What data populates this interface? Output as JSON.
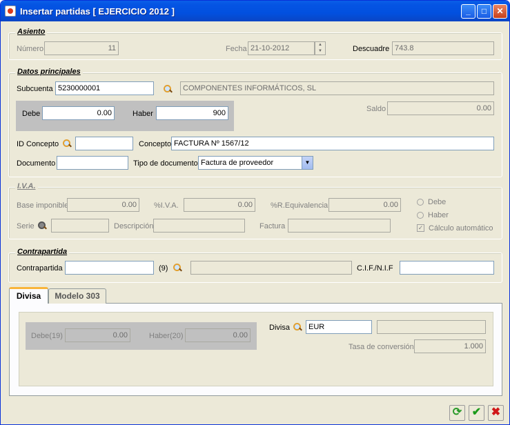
{
  "window": {
    "title": "Insertar partidas [ EJERCICIO 2012 ]"
  },
  "asiento": {
    "header": "Asiento",
    "numero_label": "Número",
    "numero_value": "11",
    "fecha_label": "Fecha",
    "fecha_value": "21-10-2012",
    "descuadre_label": "Descuadre",
    "descuadre_value": "743.8"
  },
  "principales": {
    "header": "Datos principales",
    "subcuenta_label": "Subcuenta",
    "subcuenta_value": "5230000001",
    "subcuenta_desc": "COMPONENTES INFORMÁTICOS, SL",
    "debe_label": "Debe",
    "debe_value": "0.00",
    "haber_label": "Haber",
    "haber_value": "900",
    "saldo_label": "Saldo",
    "saldo_value": "0.00",
    "idconcepto_label": "ID Concepto",
    "idconcepto_value": "",
    "concepto_label": "Concepto",
    "concepto_value": "FACTURA Nº 1567/12",
    "documento_label": "Documento",
    "documento_value": "",
    "tipodoc_label": "Tipo de documento",
    "tipodoc_value": "Factura de proveedor"
  },
  "iva": {
    "header": "I.V.A.",
    "base_label": "Base imponible",
    "base_value": "0.00",
    "piva_label": "%I.V.A.",
    "piva_value": "0.00",
    "preq_label": "%R.Equivalencia",
    "preq_value": "0.00",
    "serie_label": "Serie",
    "serie_value": "",
    "descripcion_label": "Descripción",
    "descripcion_value": "",
    "factura_label": "Factura",
    "factura_value": "",
    "debe_radio": "Debe",
    "haber_radio": "Haber",
    "calculo_label": "Cálculo automático",
    "calculo_checked": true
  },
  "contrapartida": {
    "header": "Contrapartida",
    "label": "Contrapartida",
    "value": "",
    "count": "(9)",
    "desc": "",
    "cif_label": "C.I.F./N.I.F",
    "cif_value": ""
  },
  "tabs": [
    {
      "label": "Divisa"
    },
    {
      "label": "Modelo 303"
    }
  ],
  "divisa": {
    "debe_label": "Debe(19)",
    "debe_value": "0.00",
    "haber_label": "Haber(20)",
    "haber_value": "0.00",
    "divisa_label": "Divisa",
    "divisa_value": "EUR",
    "divisa_desc": "",
    "tasa_label": "Tasa de conversión",
    "tasa_value": "1.000"
  }
}
